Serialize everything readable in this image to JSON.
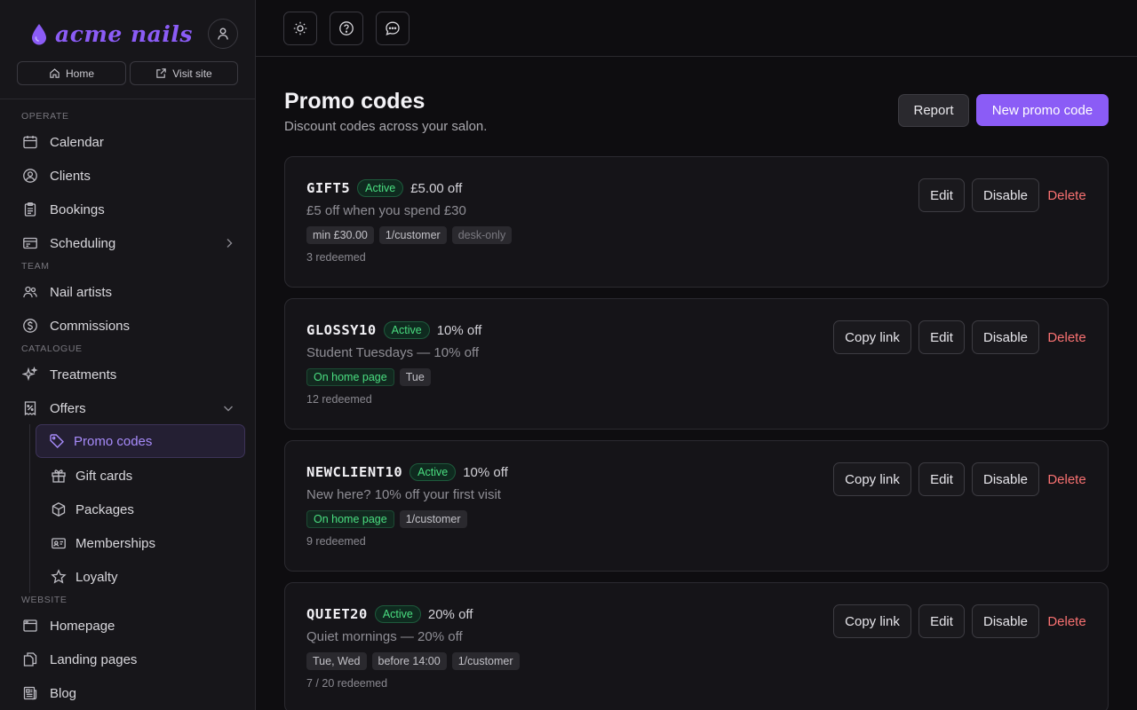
{
  "brand": {
    "name": "acme nails",
    "accent": "#8b5cf6"
  },
  "nav_quick": {
    "home": "Home",
    "visit": "Visit site"
  },
  "sections": {
    "operate": "OPERATE",
    "team": "TEAM",
    "catalogue": "CATALOGUE",
    "website": "WEBSITE"
  },
  "nav": {
    "calendar": "Calendar",
    "clients": "Clients",
    "bookings": "Bookings",
    "scheduling": "Scheduling",
    "nail_artists": "Nail artists",
    "commissions": "Commissions",
    "treatments": "Treatments",
    "offers": "Offers",
    "promo_codes": "Promo codes",
    "gift_cards": "Gift cards",
    "packages": "Packages",
    "memberships": "Memberships",
    "loyalty": "Loyalty",
    "homepage": "Homepage",
    "landing_pages": "Landing pages",
    "blog": "Blog"
  },
  "header": {
    "title": "Promo codes",
    "subtitle": "Discount codes across your salon.",
    "report_label": "Report",
    "new_label": "New promo code"
  },
  "actions": {
    "copy": "Copy link",
    "edit": "Edit",
    "disable": "Disable",
    "delete": "Delete"
  },
  "promos": [
    {
      "code": "GIFT5",
      "status": "Active",
      "discount": "£5.00 off",
      "description": "£5 off when you spend £30",
      "tags": [
        "min £30.00",
        "1/customer",
        "desk-only"
      ],
      "redeemed": "3 redeemed"
    },
    {
      "code": "GLOSSY10",
      "status": "Active",
      "discount": "10% off",
      "description": "Student Tuesdays — 10% off",
      "tags": [
        "On home page",
        "Tue"
      ],
      "redeemed": "12 redeemed"
    },
    {
      "code": "NEWCLIENT10",
      "status": "Active",
      "discount": "10% off",
      "description": "New here? 10% off your first visit",
      "tags": [
        "On home page",
        "1/customer"
      ],
      "redeemed": "9 redeemed"
    },
    {
      "code": "QUIET20",
      "status": "Active",
      "discount": "20% off",
      "description": "Quiet mornings — 20% off",
      "tags": [
        "Tue, Wed",
        "before 14:00",
        "1/customer"
      ],
      "redeemed": "7 / 20 redeemed"
    }
  ]
}
